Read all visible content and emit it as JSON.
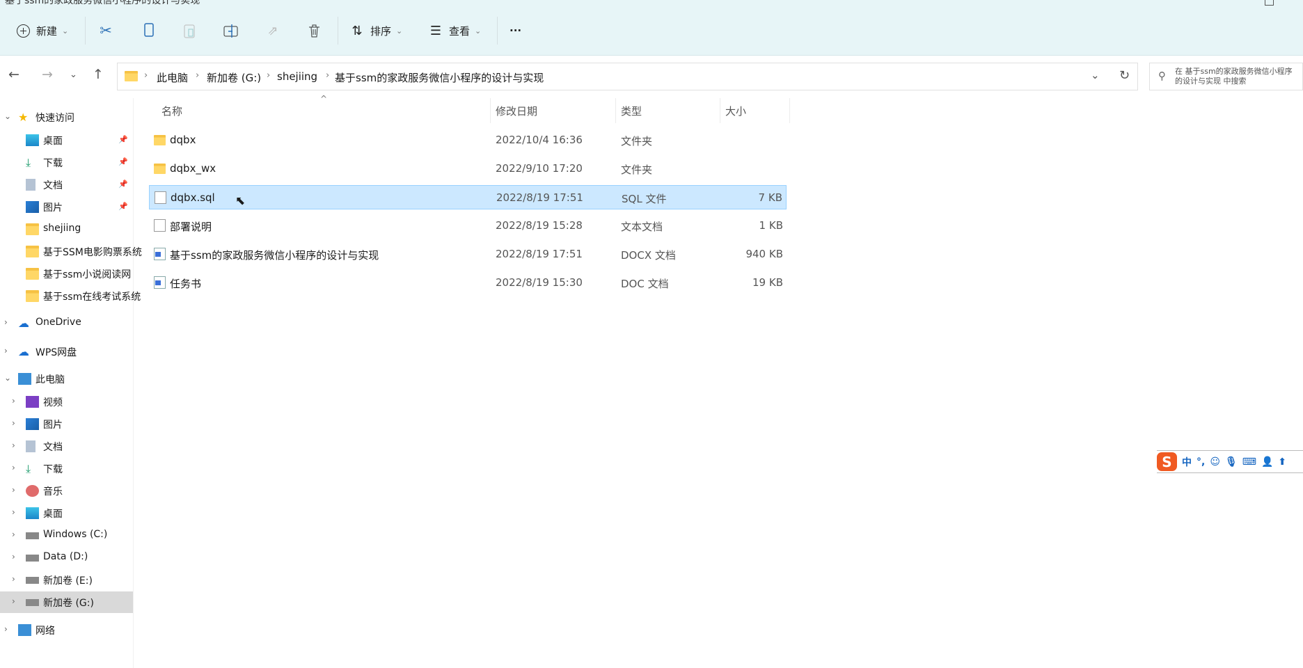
{
  "window": {
    "title": "基于ssm的家政服务微信小程序的设计与实现"
  },
  "toolbar": {
    "new": "新建",
    "sort": "排序",
    "view": "查看",
    "more": "···"
  },
  "address": {
    "crumbs": [
      "此电脑",
      "新加卷 (G:)",
      "shejiing",
      "基于ssm的家政服务微信小程序的设计与实现"
    ],
    "search_placeholder": "在 基于ssm的家政服务微信小程序的设计与实现 中搜索"
  },
  "sidebar": {
    "quick": {
      "label": "快速访问",
      "items": [
        "桌面",
        "下载",
        "文档",
        "图片",
        "shejiing",
        "基于SSM电影购票系统",
        "基于ssm小说阅读网",
        "基于ssm在线考试系统"
      ]
    },
    "onedrive": "OneDrive",
    "wps": "WPS网盘",
    "pc": {
      "label": "此电脑",
      "items": [
        "视频",
        "图片",
        "文档",
        "下载",
        "音乐",
        "桌面",
        "Windows (C:)",
        "Data (D:)",
        "新加卷 (E:)",
        "新加卷 (G:)"
      ]
    },
    "network": "网络"
  },
  "columns": {
    "name": "名称",
    "date": "修改日期",
    "type": "类型",
    "size": "大小"
  },
  "files": [
    {
      "name": "dqbx",
      "date": "2022/10/4 16:36",
      "type": "文件夹",
      "size": ""
    },
    {
      "name": "dqbx_wx",
      "date": "2022/9/10 17:20",
      "type": "文件夹",
      "size": ""
    },
    {
      "name": "dqbx.sql",
      "date": "2022/8/19 17:51",
      "type": "SQL 文件",
      "size": "7 KB"
    },
    {
      "name": "部署说明",
      "date": "2022/8/19 15:28",
      "type": "文本文档",
      "size": "1 KB"
    },
    {
      "name": "基于ssm的家政服务微信小程序的设计与实现",
      "date": "2022/8/19 17:51",
      "type": "DOCX 文档",
      "size": "940 KB"
    },
    {
      "name": "任务书",
      "date": "2022/8/19 15:30",
      "type": "DOC 文档",
      "size": "19 KB"
    }
  ],
  "ime": {
    "lang": "中",
    "punct": "°,"
  }
}
